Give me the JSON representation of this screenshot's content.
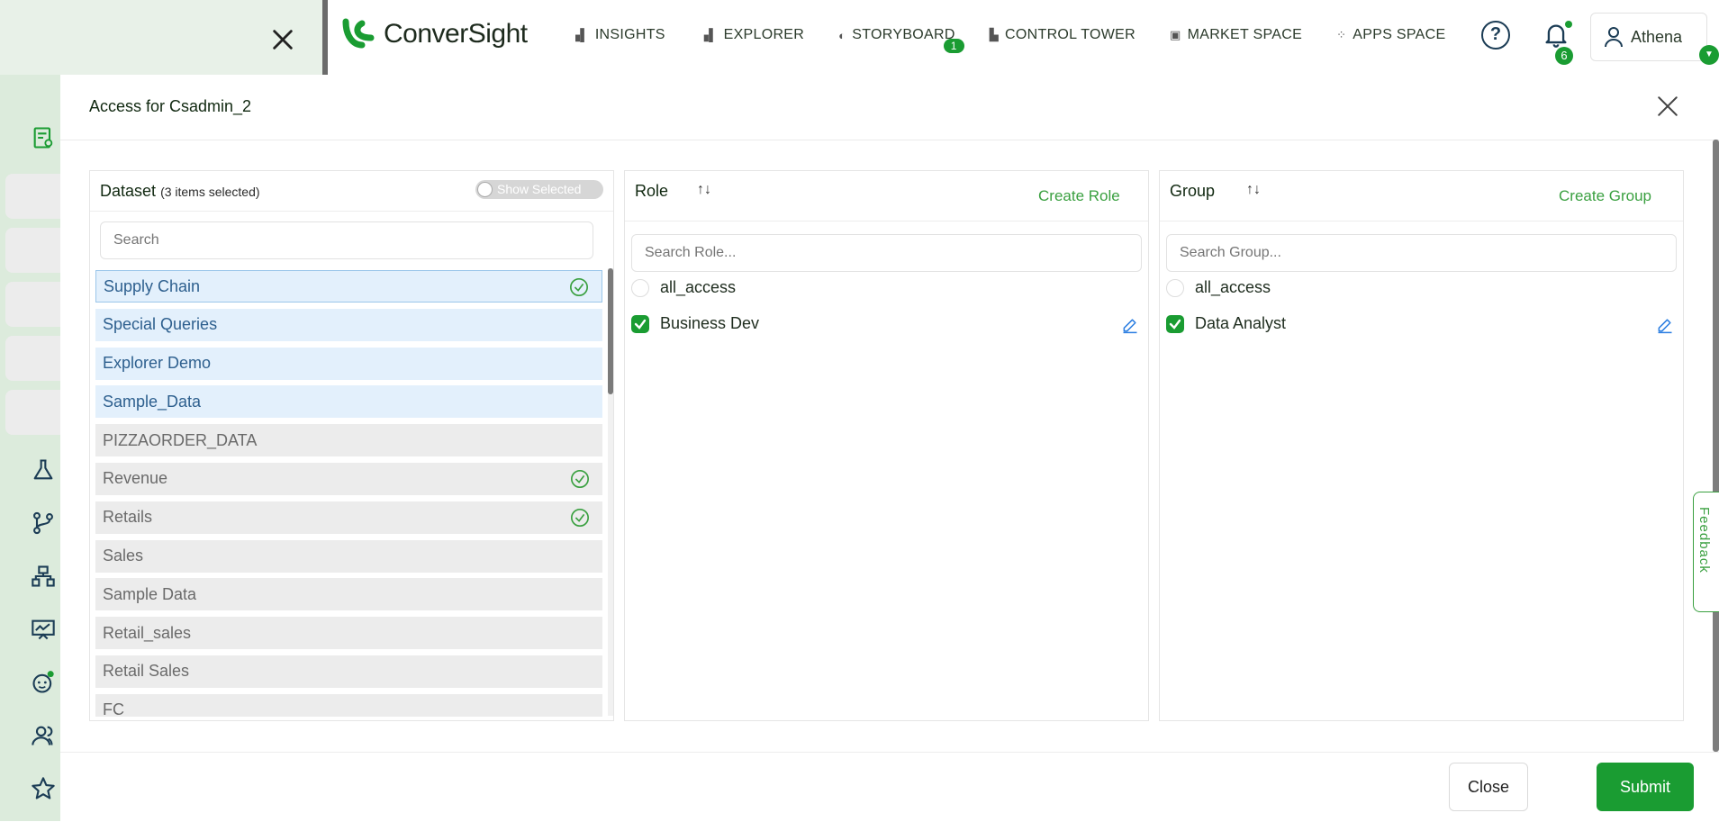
{
  "brand": {
    "name": "ConverSight",
    "color": "#1a9c32"
  },
  "nav": [
    {
      "label": "INSIGHTS",
      "icon": "bar-chart-icon"
    },
    {
      "label": "EXPLORER",
      "icon": "bar-chart-icon"
    },
    {
      "label": "STORYBOARD",
      "icon": "storyboard-icon",
      "badge": "1"
    },
    {
      "label": "CONTROL TOWER",
      "icon": "factory-icon"
    },
    {
      "label": "MARKET SPACE",
      "icon": "store-icon"
    },
    {
      "label": "APPS SPACE",
      "icon": "grid-icon"
    }
  ],
  "header": {
    "notifications_count": "6",
    "user_name": "Athena"
  },
  "modal": {
    "title": "Access for Csadmin_2",
    "dataset": {
      "title": "Dataset",
      "selected_count": "(3 items selected)",
      "toggle_label": "Show Selected",
      "search_placeholder": "Search",
      "items": [
        {
          "label": "Supply Chain",
          "state": "selected",
          "checked": true
        },
        {
          "label": "Special Queries",
          "state": "selected",
          "checked": false
        },
        {
          "label": "Explorer Demo",
          "state": "selected",
          "checked": false
        },
        {
          "label": "Sample_Data",
          "state": "selected",
          "checked": false
        },
        {
          "label": "PIZZAORDER_DATA",
          "state": "unselected",
          "checked": false
        },
        {
          "label": "Revenue",
          "state": "unselected",
          "checked": true
        },
        {
          "label": "Retails",
          "state": "unselected",
          "checked": true
        },
        {
          "label": "Sales",
          "state": "unselected",
          "checked": false
        },
        {
          "label": "Sample Data",
          "state": "unselected",
          "checked": false
        },
        {
          "label": "Retail_sales",
          "state": "unselected",
          "checked": false
        },
        {
          "label": "Retail Sales",
          "state": "unselected",
          "checked": false
        },
        {
          "label": "FC",
          "state": "unselected",
          "checked": false
        }
      ]
    },
    "role": {
      "title": "Role",
      "create_label": "Create Role",
      "search_placeholder": "Search Role...",
      "items": [
        {
          "label": "all_access",
          "checked": false,
          "editable": false
        },
        {
          "label": "Business Dev",
          "checked": true,
          "editable": true
        }
      ]
    },
    "group": {
      "title": "Group",
      "create_label": "Create Group",
      "search_placeholder": "Search Group...",
      "items": [
        {
          "label": "all_access",
          "checked": false,
          "editable": false
        },
        {
          "label": "Data Analyst",
          "checked": true,
          "editable": true
        }
      ]
    },
    "close_label": "Close",
    "submit_label": "Submit"
  },
  "feedback_label": "Feedback",
  "sidebar_icons": [
    "report-icon",
    "flask-icon",
    "branch-icon",
    "hierarchy-icon",
    "presentation-chart-icon",
    "bot-icon",
    "users-icon",
    "star-icon"
  ]
}
